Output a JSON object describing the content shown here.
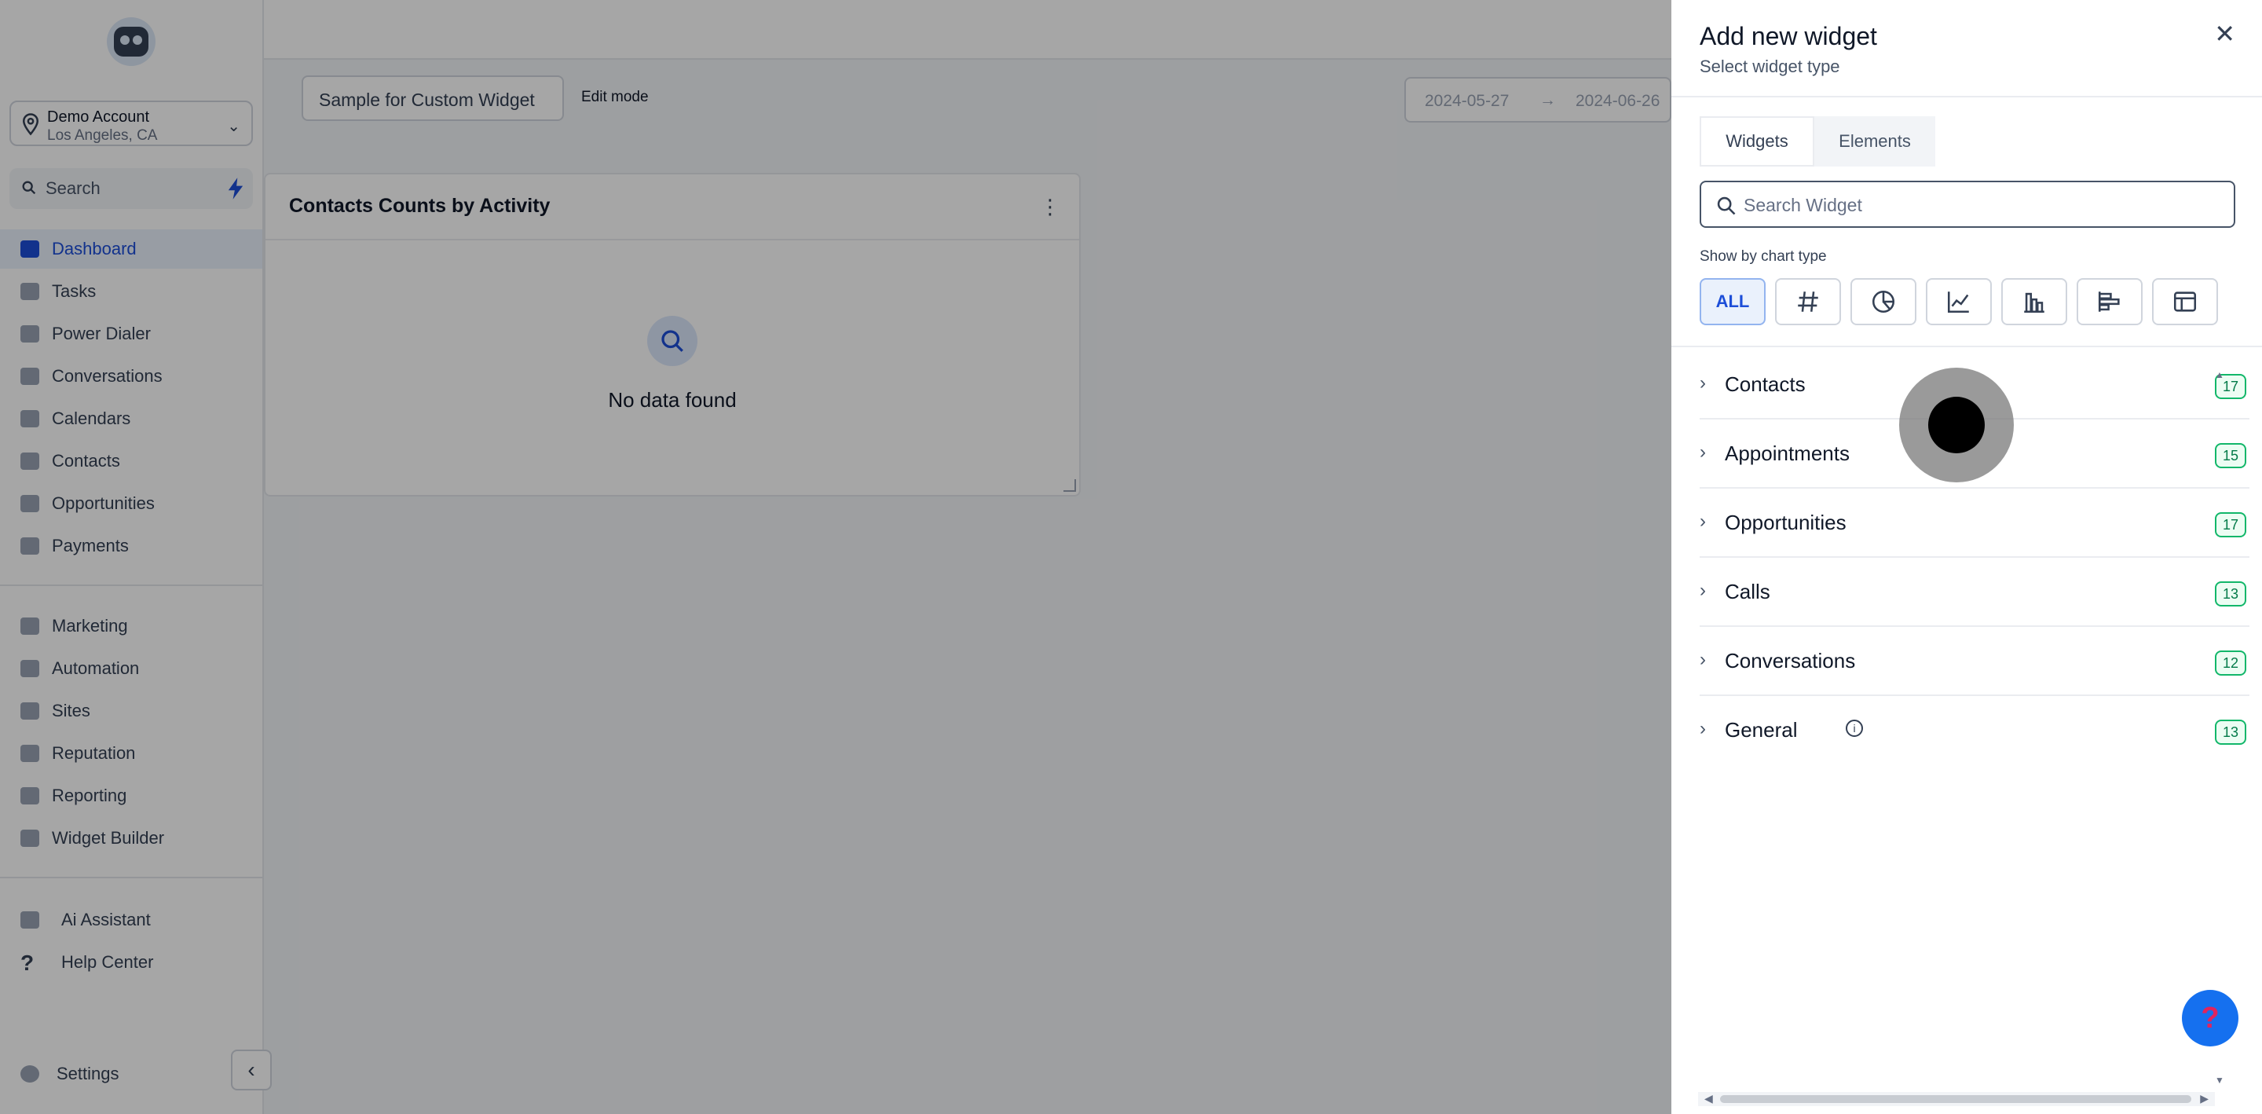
{
  "sidebar": {
    "account": {
      "name": "Demo Account",
      "location": "Los Angeles, CA"
    },
    "search_label": "Search",
    "items": [
      {
        "label": "Dashboard",
        "icon": "dashboard-icon",
        "active": true
      },
      {
        "label": "Tasks",
        "icon": "tasks-icon"
      },
      {
        "label": "Power Dialer",
        "icon": "power-dialer-icon"
      },
      {
        "label": "Conversations",
        "icon": "conversations-icon"
      },
      {
        "label": "Calendars",
        "icon": "calendar-icon"
      },
      {
        "label": "Contacts",
        "icon": "contacts-icon"
      },
      {
        "label": "Opportunities",
        "icon": "funnel-icon"
      },
      {
        "label": "Payments",
        "icon": "payments-icon"
      }
    ],
    "items2": [
      {
        "label": "Marketing",
        "icon": "megaphone-icon"
      },
      {
        "label": "Automation",
        "icon": "automation-icon"
      },
      {
        "label": "Sites",
        "icon": "sites-icon"
      },
      {
        "label": "Reputation",
        "icon": "star-icon"
      },
      {
        "label": "Reporting",
        "icon": "reporting-icon"
      },
      {
        "label": "Widget Builder",
        "icon": "widget-builder-icon"
      }
    ],
    "items3": [
      {
        "label": "Ai Assistant",
        "icon": "robot-icon"
      },
      {
        "label": "Help Center",
        "icon": "question-icon"
      }
    ],
    "settings_label": "Settings",
    "collapse_icon": "chevron-left-icon"
  },
  "toolbar": {
    "dashboard_name": "Sample for Custom Widget",
    "edit_mode": "Edit mode",
    "date_start": "2024-05-27",
    "date_arrow": "→",
    "date_end": "2024-06-26"
  },
  "card": {
    "title": "Contacts Counts by Activity",
    "empty": "No data found"
  },
  "drawer": {
    "title": "Add new widget",
    "subtitle": "Select widget type",
    "close": "✕",
    "tabs": [
      "Widgets",
      "Elements"
    ],
    "search_placeholder": "Search Widget",
    "chart_type_label": "Show by chart type",
    "chart_types": [
      "ALL",
      "number",
      "pie",
      "line",
      "bar",
      "horizontal-bar",
      "table"
    ],
    "categories": [
      {
        "label": "Contacts",
        "count": "17"
      },
      {
        "label": "Appointments",
        "count": "15"
      },
      {
        "label": "Opportunities",
        "count": "17"
      },
      {
        "label": "Calls",
        "count": "13"
      },
      {
        "label": "Conversations",
        "count": "12"
      },
      {
        "label": "General",
        "count": "13",
        "info": true
      }
    ]
  },
  "help_button": "?",
  "colors": {
    "accent": "#1d4ed8",
    "badge_border": "#12b76a",
    "help": "#1570ef"
  }
}
